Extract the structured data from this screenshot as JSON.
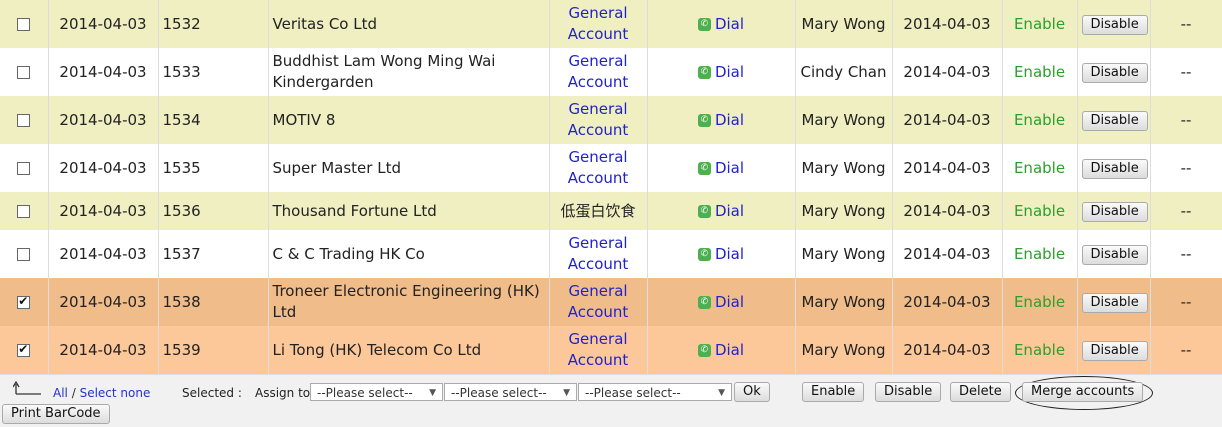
{
  "rows": [
    {
      "checked": false,
      "date": "2014-04-03",
      "id": "1532",
      "name": "Veritas Co Ltd",
      "category": "General Account",
      "dial": "Dial",
      "staff": "Mary Wong",
      "created": "2014-04-03",
      "status": "Enable",
      "action": "Disable",
      "extra": "--"
    },
    {
      "checked": false,
      "date": "2014-04-03",
      "id": "1533",
      "name": "Buddhist Lam Wong Ming Wai Kindergarden",
      "category": "General Account",
      "dial": "Dial",
      "staff": "Cindy Chan",
      "created": "2014-04-03",
      "status": "Enable",
      "action": "Disable",
      "extra": "--"
    },
    {
      "checked": false,
      "date": "2014-04-03",
      "id": "1534",
      "name": "MOTIV 8",
      "category": "General Account",
      "dial": "Dial",
      "staff": "Mary Wong",
      "created": "2014-04-03",
      "status": "Enable",
      "action": "Disable",
      "extra": "--"
    },
    {
      "checked": false,
      "date": "2014-04-03",
      "id": "1535",
      "name": "Super Master Ltd",
      "category": "General Account",
      "dial": "Dial",
      "staff": "Mary Wong",
      "created": "2014-04-03",
      "status": "Enable",
      "action": "Disable",
      "extra": "--"
    },
    {
      "checked": false,
      "date": "2014-04-03",
      "id": "1536",
      "name": "Thousand Fortune Ltd",
      "category": "低蛋白饮食",
      "dial": "Dial",
      "staff": "Mary Wong",
      "created": "2014-04-03",
      "status": "Enable",
      "action": "Disable",
      "extra": "--"
    },
    {
      "checked": false,
      "date": "2014-04-03",
      "id": "1537",
      "name": "C & C Trading HK Co",
      "category": "General Account",
      "dial": "Dial",
      "staff": "Mary Wong",
      "created": "2014-04-03",
      "status": "Enable",
      "action": "Disable",
      "extra": "--"
    },
    {
      "checked": true,
      "date": "2014-04-03",
      "id": "1538",
      "name": "Troneer Electronic Engineering (HK) Ltd",
      "category": "General Account",
      "dial": "Dial",
      "staff": "Mary Wong",
      "created": "2014-04-03",
      "status": "Enable",
      "action": "Disable",
      "extra": "--"
    },
    {
      "checked": true,
      "date": "2014-04-03",
      "id": "1539",
      "name": "Li Tong (HK) Telecom Co Ltd",
      "category": "General Account",
      "dial": "Dial",
      "staff": "Mary Wong",
      "created": "2014-04-03",
      "status": "Enable",
      "action": "Disable",
      "extra": "--"
    }
  ],
  "footer": {
    "all_link": "All",
    "separator": "/",
    "select_none_link": "Select none",
    "selected_label": "Selected :",
    "assign_label": "Assign to",
    "select1": "--Please select--",
    "select2": "--Please select--",
    "select3": "--Please select--",
    "ok_button": "Ok",
    "enable_button": "Enable",
    "disable_button": "Disable",
    "delete_button": "Delete",
    "merge_button": "Merge accounts",
    "print_button": "Print BarCode"
  },
  "colors": {
    "row_yellow": "#efefc2",
    "row_white": "#ffffff",
    "row_selected_1": "#f0bd8a",
    "row_selected_2": "#fcc89a",
    "link_blue": "#2222cc",
    "status_green": "#2aa02a"
  },
  "icons": {
    "dial": "phone-icon",
    "select_arrow": "corner-arrow-icon"
  }
}
